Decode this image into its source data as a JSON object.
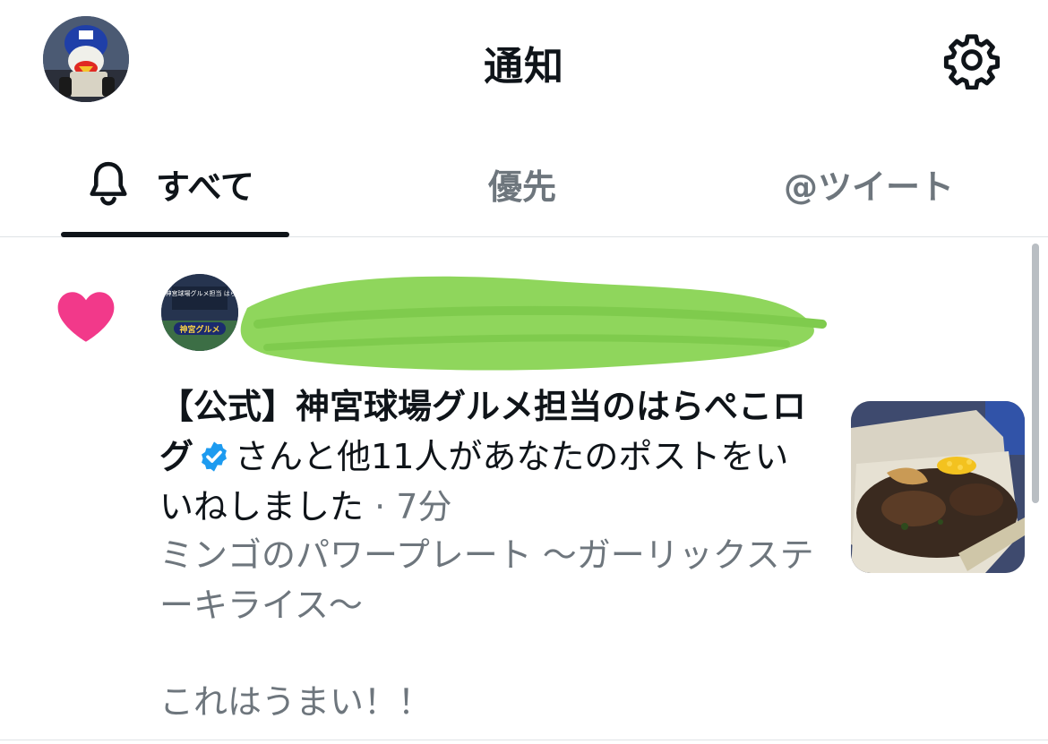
{
  "header": {
    "title": "通知",
    "avatar_icon": "profile-avatar-icon",
    "settings_icon": "gear-icon"
  },
  "tabs": [
    {
      "label": "すべて",
      "icon": "bell-icon",
      "active": true
    },
    {
      "label": "優先",
      "active": false
    },
    {
      "label": "@ツイート",
      "active": false
    }
  ],
  "notification": {
    "type_icon": "heart-icon",
    "account_name": "【公式】神宮球場グルメ担当のはらぺこログ",
    "verified_icon": "verified-badge-icon",
    "action_text": "さんと他11人があなたのポストをいいねしました",
    "time": "· 7分",
    "tweet_line1": "ミンゴのパワープレート 〜ガーリックステーキライス〜",
    "tweet_line2": "これはうまい！！",
    "avatar_caption": "【公式】 神宮球場グルメ担当 はらぺこログ",
    "avatar_badge": "神宮グルメ"
  },
  "colors": {
    "text": "#0f1419",
    "muted": "#6e767d",
    "like": "#f2398a",
    "verified": "#1d9bf0",
    "redaction": "#8fd65c"
  }
}
